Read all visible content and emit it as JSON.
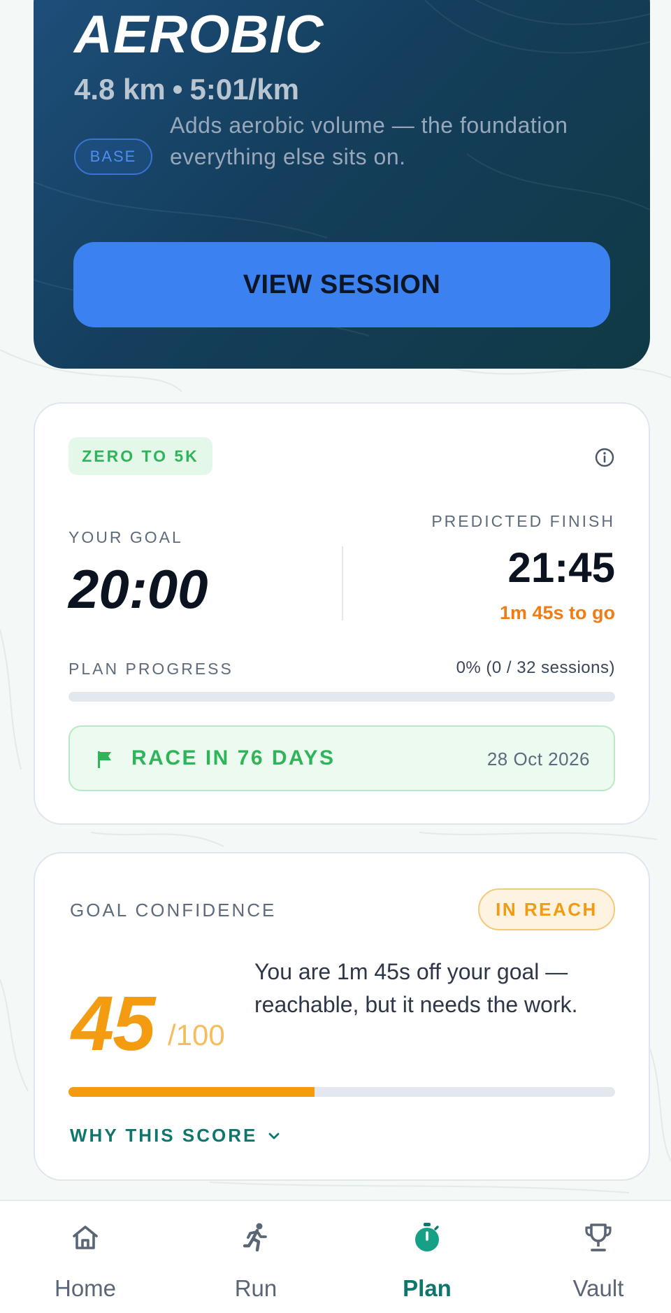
{
  "hero": {
    "title": "AEROBIC",
    "distance": "4.8 km",
    "separator": "•",
    "pace": "5:01/km",
    "badge": "BASE",
    "description": "Adds aerobic volume — the foundation everything else sits on.",
    "button_label": "VIEW SESSION"
  },
  "plan_card": {
    "plan_tag": "ZERO TO 5K",
    "info_icon": "info-circle-icon",
    "goal_label": "YOUR GOAL",
    "goal_time": "20:00",
    "predicted_label": "PREDICTED FINISH",
    "predicted_time": "21:45",
    "to_go": "1m 45s to go",
    "progress_label": "PLAN PROGRESS",
    "progress_value": "0%  (0 / 32 sessions)",
    "progress_fraction": 0,
    "race_icon": "flag-icon",
    "race_label": "RACE IN 76 DAYS",
    "race_date": "28 Oct 2026"
  },
  "confidence_card": {
    "label": "GOAL CONFIDENCE",
    "status": "IN REACH",
    "score": "45",
    "score_max": "/100",
    "score_fraction": 0.45,
    "description": "You are 1m 45s off your goal — reachable, but it needs the work.",
    "why_link": "WHY THIS SCORE",
    "why_icon": "chevron-down-icon"
  },
  "nav": {
    "items": [
      {
        "label": "Home",
        "icon": "home-icon",
        "active": false
      },
      {
        "label": "Run",
        "icon": "runner-icon",
        "active": false
      },
      {
        "label": "Plan",
        "icon": "stopwatch-icon",
        "active": true
      },
      {
        "label": "Vault",
        "icon": "trophy-icon",
        "active": false
      }
    ]
  },
  "colors": {
    "accent_blue": "#3b82f0",
    "brand_teal": "#0f766e",
    "success_green": "#2fb45a",
    "warning_orange": "#f39c12"
  }
}
